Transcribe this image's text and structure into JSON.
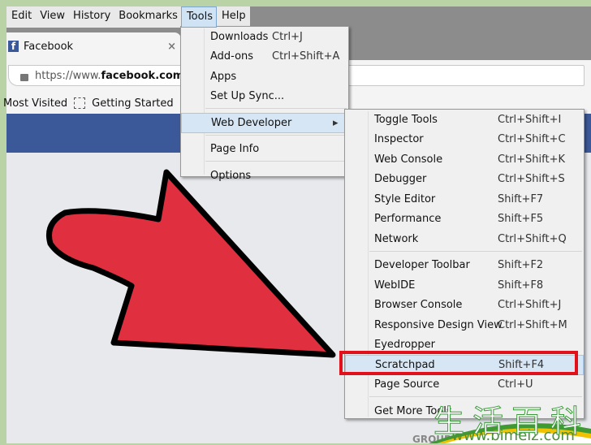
{
  "menubar": {
    "items": [
      "Edit",
      "View",
      "History",
      "Bookmarks",
      "Tools",
      "Help"
    ],
    "active": "Tools"
  },
  "tab": {
    "title": "Facebook",
    "close": "×",
    "icon": "facebook-icon"
  },
  "address": {
    "prefix": "https://www.",
    "domain": "facebook.com"
  },
  "bookmarks": [
    "Most Visited",
    "Getting Started"
  ],
  "tools_menu": [
    {
      "label": "Downloads",
      "shortcut": "Ctrl+J"
    },
    {
      "label": "Add-ons",
      "shortcut": "Ctrl+Shift+A"
    },
    {
      "label": "Apps",
      "shortcut": ""
    },
    {
      "label": "Set Up Sync...",
      "shortcut": ""
    },
    {
      "label": "Web Developer",
      "shortcut": "▸"
    },
    {
      "label": "Page Info",
      "shortcut": ""
    },
    {
      "label": "Options",
      "shortcut": ""
    }
  ],
  "webdev_menu": [
    {
      "label": "Toggle Tools",
      "shortcut": "Ctrl+Shift+I"
    },
    {
      "label": "Inspector",
      "shortcut": "Ctrl+Shift+C"
    },
    {
      "label": "Web Console",
      "shortcut": "Ctrl+Shift+K"
    },
    {
      "label": "Debugger",
      "shortcut": "Ctrl+Shift+S"
    },
    {
      "label": "Style Editor",
      "shortcut": "Shift+F7"
    },
    {
      "label": "Performance",
      "shortcut": "Shift+F5"
    },
    {
      "label": "Network",
      "shortcut": "Ctrl+Shift+Q"
    },
    {
      "label": "Developer Toolbar",
      "shortcut": "Shift+F2"
    },
    {
      "label": "WebIDE",
      "shortcut": "Shift+F8"
    },
    {
      "label": "Browser Console",
      "shortcut": "Ctrl+Shift+J"
    },
    {
      "label": "Responsive Design View",
      "shortcut": "Ctrl+Shift+M"
    },
    {
      "label": "Eyedropper",
      "shortcut": ""
    },
    {
      "label": "Scratchpad",
      "shortcut": "Shift+F4"
    },
    {
      "label": "Page Source",
      "shortcut": "Ctrl+U"
    },
    {
      "label": "Get More Tools",
      "shortcut": ""
    }
  ],
  "page": {
    "groups": "GROUPS"
  },
  "watermark": {
    "chars": "生活百科",
    "url": "www.bimeiz.com"
  },
  "colors": {
    "highlight": "#e2101b",
    "arrow": "#e0303f",
    "facebook": "#3b5998"
  }
}
